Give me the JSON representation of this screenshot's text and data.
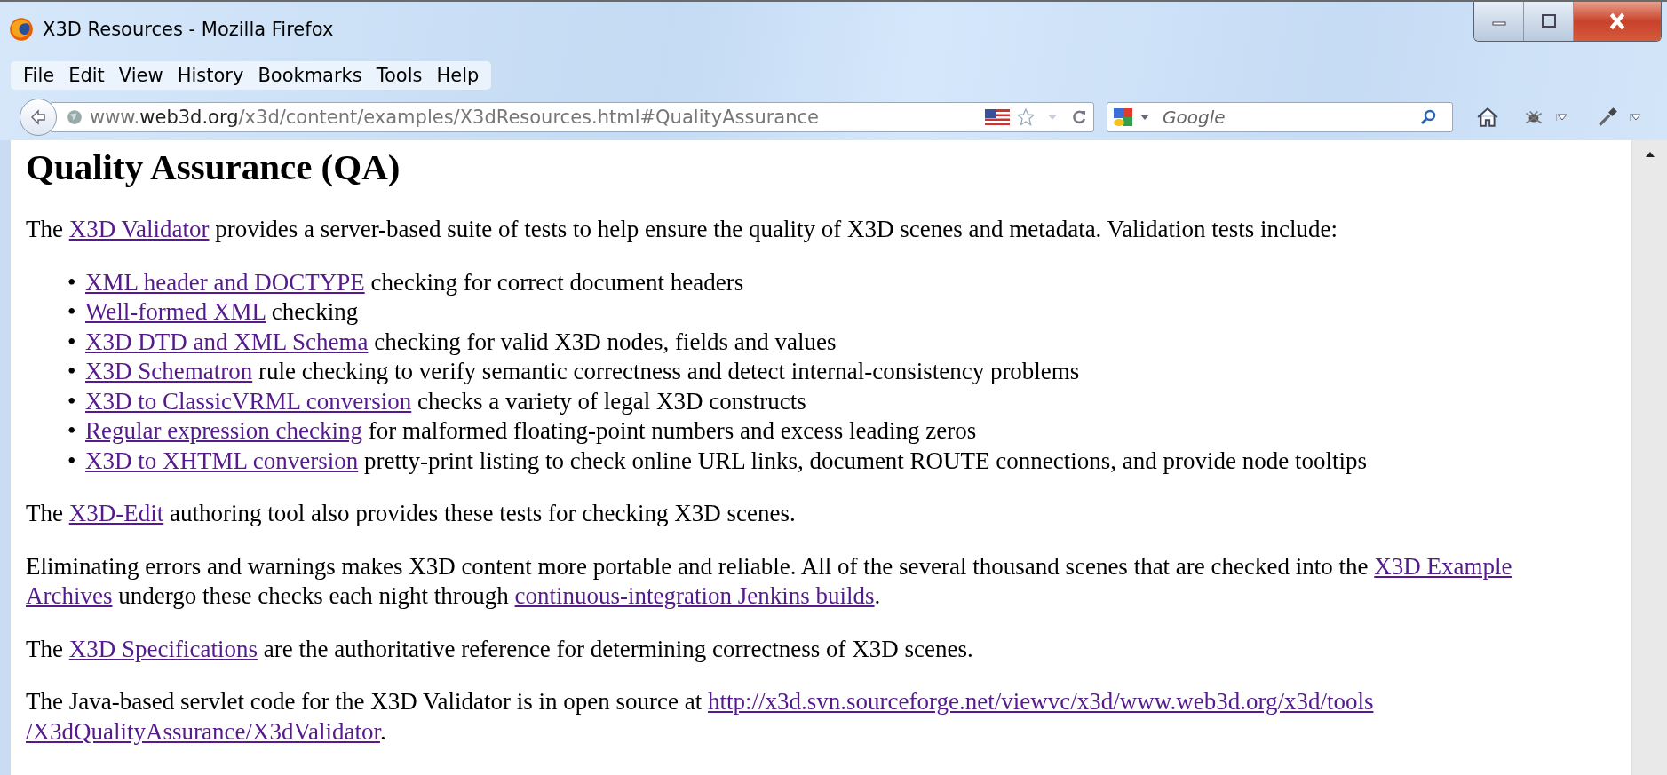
{
  "window": {
    "title": "X3D Resources - Mozilla Firefox"
  },
  "menu": [
    "File",
    "Edit",
    "View",
    "History",
    "Bookmarks",
    "Tools",
    "Help"
  ],
  "address": {
    "prefix": "www.",
    "domain": "web3d.org",
    "path": "/x3d/content/examples/X3dResources.html#QualityAssurance"
  },
  "search": {
    "placeholder": "Google"
  },
  "page": {
    "heading": "Quality Assurance (QA)",
    "intro": [
      {
        "text": "The "
      },
      {
        "text": "X3D Validator",
        "link": true
      },
      {
        "text": " provides a server-based suite of tests to help ensure the quality of X3D scenes and metadata. Validation tests include:"
      }
    ],
    "bullets": [
      {
        "marker": "•",
        "parts": [
          {
            "text": "XML header and DOCTYPE",
            "link": true
          },
          {
            "text": " checking for correct document headers"
          }
        ]
      },
      {
        "marker": "•",
        "parts": [
          {
            "text": "Well-formed XML",
            "link": true
          },
          {
            "text": " checking"
          }
        ]
      },
      {
        "marker": "•",
        "parts": [
          {
            "text": "X3D DTD and XML Schema",
            "link": true
          },
          {
            "text": " checking for valid X3D nodes, fields and values"
          }
        ]
      },
      {
        "marker": "•",
        "parts": [
          {
            "text": "X3D Schematron",
            "link": true
          },
          {
            "text": " rule checking to verify semantic correctness and detect internal-consistency problems"
          }
        ]
      },
      {
        "marker": "•",
        "parts": [
          {
            "text": "X3D to ClassicVRML conversion",
            "link": true
          },
          {
            "text": " checks a variety of legal X3D constructs"
          }
        ]
      },
      {
        "marker": "•",
        "parts": [
          {
            "text": "Regular expression checking",
            "link": true
          },
          {
            "text": " for malformed floating-point numbers and excess leading zeros"
          }
        ]
      },
      {
        "marker": "•",
        "parts": [
          {
            "text": "X3D to XHTML conversion",
            "link": true
          },
          {
            "text": " pretty-print listing to check online URL links, document ROUTE connections, and provide node tooltips"
          }
        ]
      }
    ],
    "paragraphs": [
      [
        [
          {
            "text": "The "
          },
          {
            "text": "X3D-Edit",
            "link": true
          },
          {
            "text": " authoring tool also provides these tests for checking X3D scenes."
          }
        ]
      ],
      [
        [
          {
            "text": "Eliminating errors and warnings makes X3D content more portable and reliable. All of the several thousand scenes that are checked into the "
          },
          {
            "text": "X3D Example",
            "link": true
          }
        ],
        [
          {
            "text": "Archives",
            "link": true
          },
          {
            "text": " undergo these checks each night through "
          },
          {
            "text": "continuous-integration Jenkins builds",
            "link": true
          },
          {
            "text": "."
          }
        ]
      ],
      [
        [
          {
            "text": "The "
          },
          {
            "text": "X3D Specifications",
            "link": true
          },
          {
            "text": " are the authoritative reference for determining correctness of X3D scenes."
          }
        ]
      ],
      [
        [
          {
            "text": "The Java-based servlet code for the X3D Validator is in open source at "
          },
          {
            "text": "http://x3d.svn.sourceforge.net/viewvc/x3d/www.web3d.org/x3d/tools",
            "link": true
          }
        ],
        [
          {
            "text": "/X3dQualityAssurance/X3dValidator",
            "link": true
          },
          {
            "text": "."
          }
        ]
      ]
    ]
  }
}
